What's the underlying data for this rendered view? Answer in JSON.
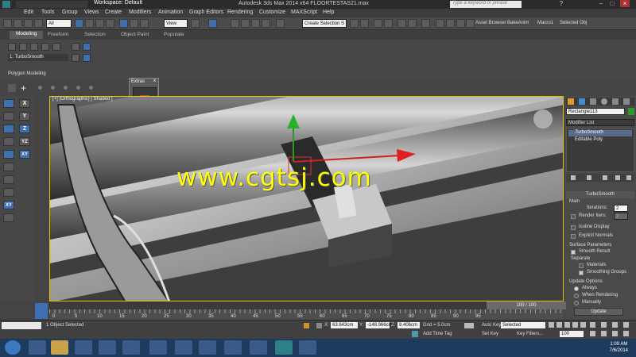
{
  "title": {
    "workspace": "Workspace: Default",
    "text": "Autodesk 3ds Max 2014 x64     FLOORTESTAS21.max",
    "search_placeholder": "Type a keyword or phrase"
  },
  "menu": [
    "Edit",
    "Tools",
    "Group",
    "Views",
    "Create",
    "Modifiers",
    "Animation",
    "Graph Editors",
    "Rendering",
    "Customize",
    "MAXScript",
    "Help"
  ],
  "toolbar": {
    "filter": "All",
    "coord": "View",
    "selection_set": "Create Selection S",
    "asset_browser": "Asset Browser",
    "bake_anim": "BakeAnim",
    "macro": "Macro1",
    "selected_obj": "Selected Obj"
  },
  "ribbon": {
    "tabs": [
      "Modeling",
      "Freeform",
      "Selection",
      "Object Paint",
      "Populate"
    ],
    "active_tab": "Modeling",
    "modifier_label": "1: TurboSmooth",
    "group_label": "Polygon Modeling",
    "extras_label": "Extras"
  },
  "viewport": {
    "label": "[+] [Orthographic] [ Shaded ]",
    "watermark": "www.cgtsj.com"
  },
  "axis_buttons": [
    "X",
    "Y",
    "Z",
    "YZ",
    "XY",
    "XY"
  ],
  "command_panel": {
    "object_name": "Rectangle113",
    "modifier_list": "Modifier List",
    "stack": [
      "TurboSmooth",
      "Editable Poly"
    ],
    "rollout_title": "TurboSmooth",
    "main_label": "Main",
    "iterations_label": "Iterations:",
    "iterations_value": "2",
    "render_iters_label": "Render Iters:",
    "render_iters_value": "2",
    "isoline": "Isoline Display",
    "explicit_normals": "Explicit Normals",
    "surface_params": "Surface Parameters",
    "smooth_result": "Smooth Result",
    "separate": "Separate",
    "materials": "Materials",
    "smoothing_groups": "Smoothing Groups",
    "update_options": "Update Options",
    "always": "Always",
    "when_rendering": "When Rendering",
    "manually": "Manually",
    "update_button": "Update"
  },
  "timeline": {
    "frame": "100 / 100",
    "ticks": [
      "0",
      "5",
      "10",
      "15",
      "20",
      "25",
      "30",
      "35",
      "40",
      "45",
      "50",
      "55",
      "60",
      "65",
      "70",
      "75",
      "80",
      "85",
      "90",
      "95"
    ]
  },
  "status": {
    "selection": "1 Object Selected",
    "x_label": "X:",
    "x_value": "63.643cm",
    "y_label": "Y:",
    "y_value": "-148.966cm",
    "z_label": "Z:",
    "z_value": "9.406cm",
    "grid": "Grid = 5.0cm",
    "add_time_tag": "Add Time Tag",
    "auto_key": "Auto Key",
    "auto_key_value": "Selected",
    "set_key": "Set Key",
    "key_filters": "Key Filters...",
    "frame_value": "100"
  },
  "taskbar": {
    "time": "1:09 AM",
    "date": "7/6/2014"
  }
}
